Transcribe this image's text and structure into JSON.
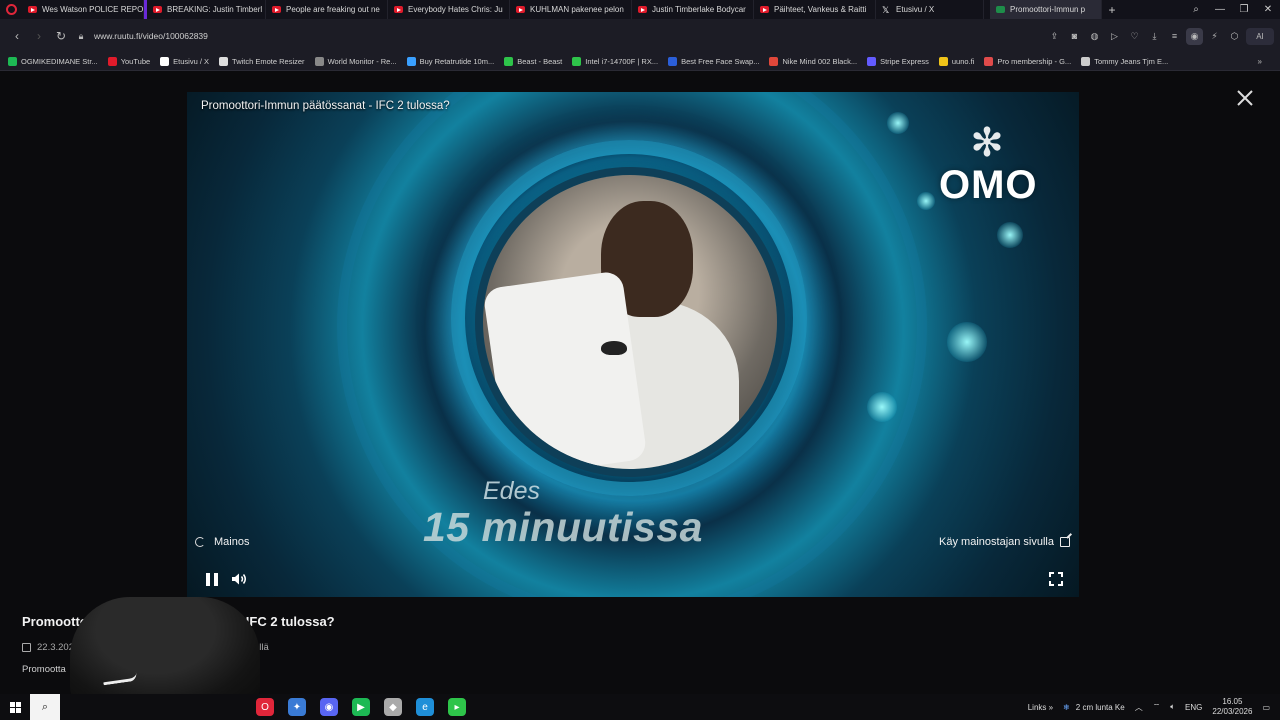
{
  "browser": {
    "tabs": [
      {
        "title": "Wes Watson POLICE REPO",
        "icon": "youtube-icon"
      },
      {
        "title": "BREAKING: Justin Timberl",
        "icon": "youtube-icon"
      },
      {
        "title": "People are freaking out ne",
        "icon": "youtube-icon"
      },
      {
        "title": "Everybody Hates Chris: Ju",
        "icon": "youtube-icon"
      },
      {
        "title": "KUHLMAN pakenee pelon",
        "icon": "youtube-icon"
      },
      {
        "title": "Justin Timberlake Bodycar",
        "icon": "youtube-icon"
      },
      {
        "title": "Päihteet, Vankeus & Raitti",
        "icon": "youtube-icon"
      },
      {
        "title": "Etusivu / X",
        "icon": "x-icon"
      }
    ],
    "active_tab": {
      "title": "Promoottori-Immun p"
    },
    "new_tab_symbol": "+",
    "url": "www.ruutu.fi/video/100062839",
    "ai_label": "AI",
    "bookmarks": [
      {
        "label": "OGMIKEDIMANE Str...",
        "color": "#1db954"
      },
      {
        "label": "YouTube",
        "color": "#e01b2b"
      },
      {
        "label": "Etusivu / X",
        "color": "#ffffff"
      },
      {
        "label": "Twitch Emote Resizer",
        "color": "#dddddd"
      },
      {
        "label": "World Monitor - Re...",
        "color": "#888888"
      },
      {
        "label": "Buy Retatrutide 10m...",
        "color": "#3aa0ff"
      },
      {
        "label": "Beast - Beast",
        "color": "#2ec44a"
      },
      {
        "label": "Intel i7-14700F | RX...",
        "color": "#2ec44a"
      },
      {
        "label": "Best Free Face Swap...",
        "color": "#2b5fd9"
      },
      {
        "label": "Nike Mind 002 Black...",
        "color": "#e0473a"
      },
      {
        "label": "Stripe Express",
        "color": "#635bff"
      },
      {
        "label": "uuno.fi",
        "color": "#f0c419"
      },
      {
        "label": "Pro membership - G...",
        "color": "#e04b4b"
      },
      {
        "label": "Tommy Jeans Tjm E...",
        "color": "#cccccc"
      }
    ]
  },
  "player": {
    "video_title": "Promoottori-Immun päätössanat - IFC 2 tulossa?",
    "ad_label": "Mainos",
    "advertiser_link": "Käy mainostajan sivulla",
    "brand": "OMO",
    "promo_line1": "Edes",
    "promo_line2": "15 minuutissa"
  },
  "details": {
    "title": "Promootto",
    "title_tail": "nat - IFC 2 tulossa?",
    "date": "22.3.202",
    "availability": "yli vuosi jäljellä",
    "description": "Promootta"
  },
  "taskbar": {
    "links_label": "Links",
    "weather": "2 cm lunta Ke",
    "language": "ENG",
    "time": "16.05",
    "date": "22/03/2026",
    "apps": [
      {
        "name": "opera-app",
        "color": "#e0263a",
        "glyph": "O"
      },
      {
        "name": "copilot-app",
        "color": "#3a7bd5",
        "glyph": "✦"
      },
      {
        "name": "discord-app",
        "color": "#5865f2",
        "glyph": "◉"
      },
      {
        "name": "spotify-app",
        "color": "#1db954",
        "glyph": "▶"
      },
      {
        "name": "shield-app",
        "color": "#aaaaaa",
        "glyph": "◆"
      },
      {
        "name": "edge-app",
        "color": "#1f8fd8",
        "glyph": "e"
      },
      {
        "name": "terminal-app",
        "color": "#2ec44a",
        "glyph": "▸"
      }
    ]
  }
}
